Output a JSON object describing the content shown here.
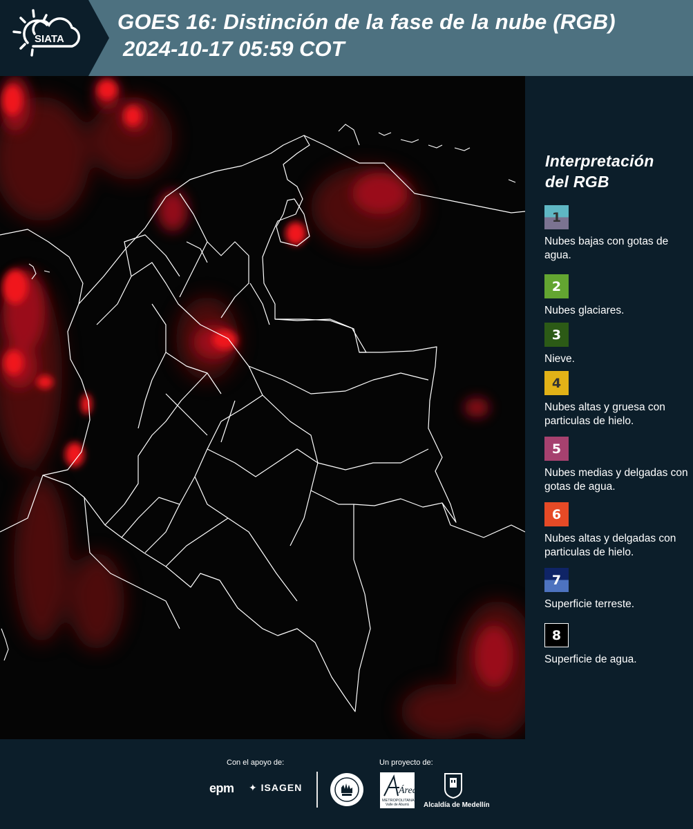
{
  "header": {
    "logo_text": "SIATA",
    "title": "GOES 16: Distinción de la fase de la nube (RGB)",
    "subtitle": "2024-10-17 05:59 COT"
  },
  "legend": {
    "title_line1": "Interpretación",
    "title_line2": "del RGB",
    "items": [
      {
        "num": "1",
        "label": "Nubes bajas con gotas de agua.",
        "color_top": "#5fb7c4",
        "color_bottom": "#7b7391",
        "text_color": "#333333"
      },
      {
        "num": "2",
        "label": "Nubes glaciares.",
        "color_top": "#63a531",
        "color_bottom": "#63a531",
        "text_color": "#ffffff"
      },
      {
        "num": "3",
        "label": "Nieve.",
        "color_top": "#2c5a16",
        "color_bottom": "#2c5a16",
        "text_color": "#ffffff"
      },
      {
        "num": "4",
        "label": "Nubes altas y gruesa con particulas de hielo.",
        "color_top": "#e2b217",
        "color_bottom": "#e2b217",
        "text_color": "#333333"
      },
      {
        "num": "5",
        "label": "Nubes medias y delgadas con gotas de agua.",
        "color_top": "#a6416f",
        "color_bottom": "#a6416f",
        "text_color": "#ffffff"
      },
      {
        "num": "6",
        "label": "Nubes altas y delgadas con particulas de hielo.",
        "color_top": "#e64a26",
        "color_bottom": "#e64a26",
        "text_color": "#ffffff"
      },
      {
        "num": "7",
        "label": "Superficie terreste.",
        "color_top": "#0f2466",
        "color_bottom": "#4d73bf",
        "text_color": "#ffffff"
      },
      {
        "num": "8",
        "label": "Superficie de agua.",
        "color_top": "#000000",
        "color_bottom": "#000000",
        "text_color": "#ffffff"
      }
    ]
  },
  "footer": {
    "support_caption": "Con el apoyo de:",
    "project_caption": "Un proyecto de:",
    "sponsor_epm": "epm",
    "sponsor_isagen": "ISAGEN",
    "area_main": "Área",
    "area_sub1": "METROPOLITANA",
    "area_sub2": "Valle de Aburrá",
    "alcaldia": "Alcaldía de Medellín"
  },
  "colors": {
    "header_bg": "#4d7180",
    "panel_bg": "#0c1e2a",
    "map_bg": "#050505",
    "cloud_red": "#e8141a"
  }
}
